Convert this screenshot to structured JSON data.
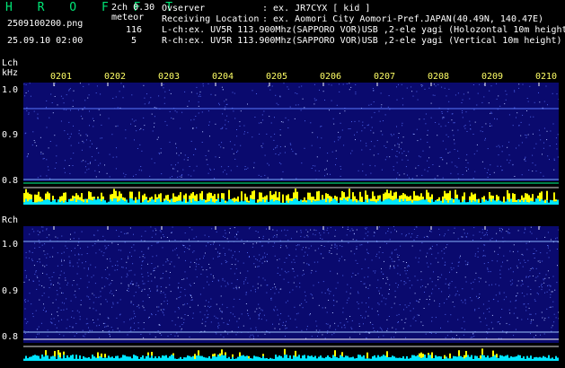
{
  "header": {
    "app_title": "H R O F F T",
    "version": "2ch 0.30",
    "filename": "2509100200.png",
    "datetime": "25.09.10 02:00",
    "mode": "meteor",
    "lch_count": "116",
    "rch_count": "5",
    "observer_label": "Ovserver",
    "observer_value": ": ex. JR7CYX [ kid ]",
    "location_label": "Receiving Location",
    "location_value": ": ex. Aomori City Aomori-Pref.JAPAN(40.49N, 140.47E)",
    "lch_info": "L-ch:ex. UV5R 113.900Mhz(SAPPORO VOR)USB ,2-ele yagi (Holozontal 10m height)",
    "rch_info": "R-ch:ex. UV5R 113.900Mhz(SAPPORO VOR)USB ,2-ele yagi (Vertical 10m height)"
  },
  "lch_panel": {
    "label": "Lch",
    "unit": "kHz",
    "ticks": [
      "1.0",
      "0.9",
      "0.8"
    ]
  },
  "rch_panel": {
    "label": "Rch",
    "ticks": [
      "1.0",
      "0.9",
      "0.8"
    ]
  },
  "time_labels": [
    "0201",
    "0202",
    "0203",
    "0204",
    "0205",
    "0206",
    "0207",
    "0208",
    "0209",
    "0210"
  ],
  "colors": {
    "background": "#000000",
    "waterfall_base": "#0a0a6e",
    "noise_dot": "#6a7dff",
    "level_yellow": "#ffff00",
    "level_cyan": "#00e5ff",
    "title_green": "#00e676",
    "label_yellow": "#ffff66"
  }
}
